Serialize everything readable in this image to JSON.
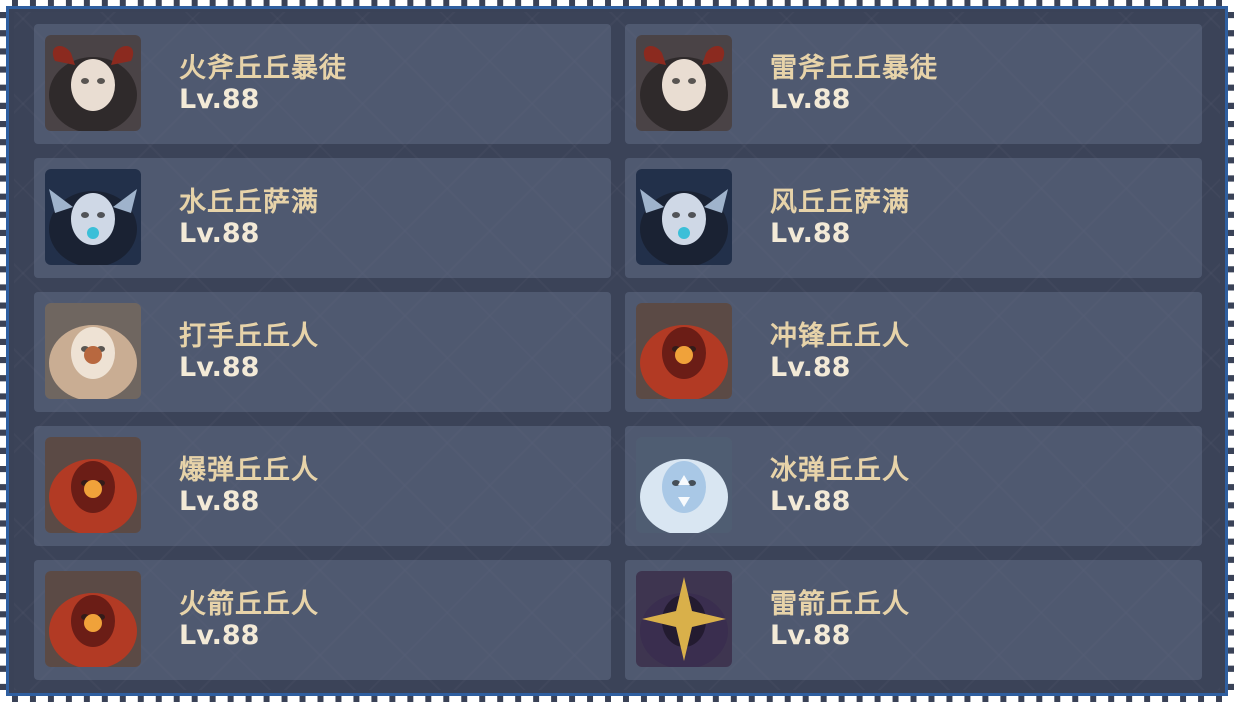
{
  "enemies": [
    {
      "name": "火斧丘丘暴徒",
      "level": "Lv.88",
      "icon": "hilichurl-mask-horned-icon",
      "palette": {
        "bg": "#4a4346",
        "fur": "#2f2a2b",
        "mask": "#e9ddd2",
        "accent": "#8b2a1f"
      }
    },
    {
      "name": "雷斧丘丘暴徒",
      "level": "Lv.88",
      "icon": "hilichurl-mask-horned-icon",
      "palette": {
        "bg": "#4a4346",
        "fur": "#2f2a2b",
        "mask": "#e9ddd2",
        "accent": "#8b2a1f"
      }
    },
    {
      "name": "水丘丘萨满",
      "level": "Lv.88",
      "icon": "shaman-mask-icon",
      "palette": {
        "bg": "#22304a",
        "fur": "#1a2233",
        "mask": "#cfd8e6",
        "accent": "#3bbfd8"
      }
    },
    {
      "name": "风丘丘萨满",
      "level": "Lv.88",
      "icon": "shaman-mask-icon",
      "palette": {
        "bg": "#22304a",
        "fur": "#1a2233",
        "mask": "#cfd8e6",
        "accent": "#3bbfd8"
      }
    },
    {
      "name": "打手丘丘人",
      "level": "Lv.88",
      "icon": "hilichurl-fighter-icon",
      "palette": {
        "bg": "#6f6660",
        "fur": "#c9ad93",
        "mask": "#eee2d4",
        "accent": "#b8683f"
      }
    },
    {
      "name": "冲锋丘丘人",
      "level": "Lv.88",
      "icon": "hilichurl-berserker-icon",
      "palette": {
        "bg": "#5b4a45",
        "fur": "#b23a24",
        "mask": "#6b1d16",
        "accent": "#f0a23a"
      }
    },
    {
      "name": "爆弹丘丘人",
      "level": "Lv.88",
      "icon": "hilichurl-bomber-icon",
      "palette": {
        "bg": "#5b4a45",
        "fur": "#b23a24",
        "mask": "#6b1d16",
        "accent": "#f0a23a"
      }
    },
    {
      "name": "冰弹丘丘人",
      "level": "Lv.88",
      "icon": "hilichurl-cryo-icon",
      "palette": {
        "bg": "#4f5d72",
        "fur": "#d9e6f2",
        "mask": "#a9c8e6",
        "accent": "#ffffff"
      }
    },
    {
      "name": "火箭丘丘人",
      "level": "Lv.88",
      "icon": "hilichurl-pyro-archer-icon",
      "palette": {
        "bg": "#5b4a45",
        "fur": "#b23a24",
        "mask": "#6b1d16",
        "accent": "#f0a23a"
      }
    },
    {
      "name": "雷箭丘丘人",
      "level": "Lv.88",
      "icon": "hilichurl-electro-archer-icon",
      "palette": {
        "bg": "#3e3550",
        "fur": "#3a2e4f",
        "mask": "#231b30",
        "accent": "#d9b04a"
      }
    }
  ]
}
